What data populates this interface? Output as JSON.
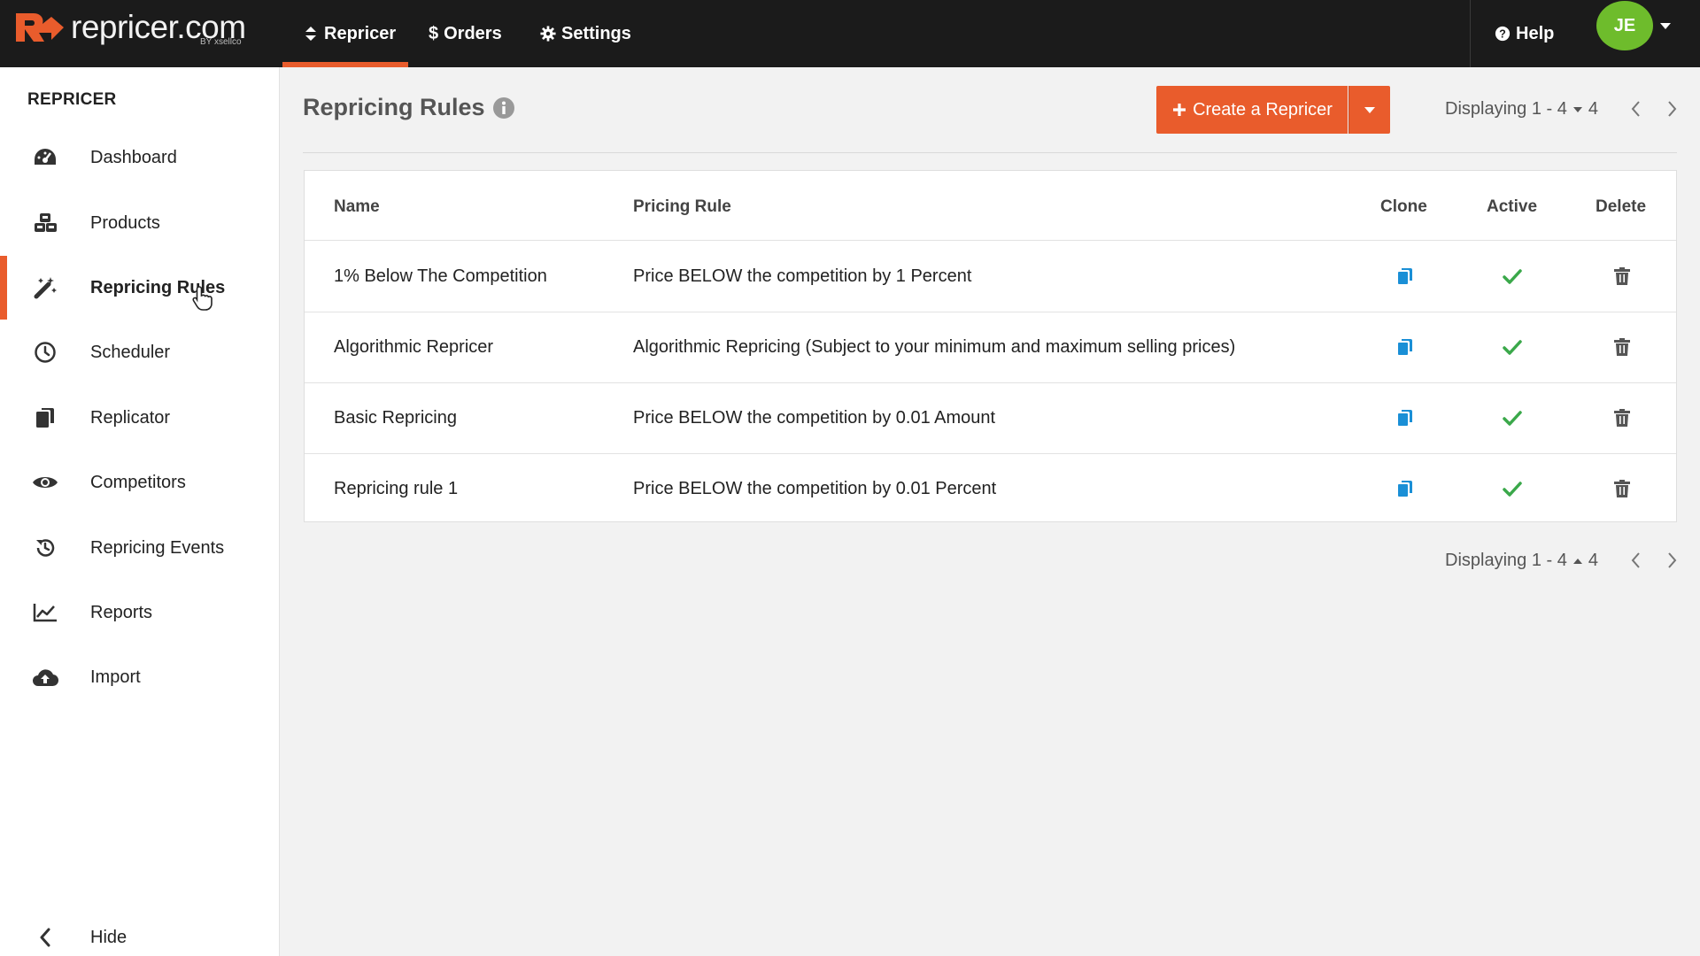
{
  "brand": {
    "name": "repricer.com",
    "sub": "BY xsellco",
    "accent": "#e95c2c"
  },
  "topnav": {
    "items": [
      {
        "label": "Repricer",
        "icon": "sort-icon"
      },
      {
        "label": "Orders",
        "icon": "dollar-icon"
      },
      {
        "label": "Settings",
        "icon": "gear-icon"
      }
    ],
    "active": "Repricer",
    "help": {
      "label": "Help",
      "icon": "question-circle-icon"
    },
    "user": {
      "initials": "JE",
      "color": "#6ebc2c"
    }
  },
  "sidebar": {
    "title": "REPRICER",
    "items": [
      {
        "label": "Dashboard",
        "icon": "dashboard-icon"
      },
      {
        "label": "Products",
        "icon": "cubes-icon"
      },
      {
        "label": "Repricing Rules",
        "icon": "magic-wand-icon",
        "active": true
      },
      {
        "label": "Scheduler",
        "icon": "clock-icon"
      },
      {
        "label": "Replicator",
        "icon": "copy-icon"
      },
      {
        "label": "Competitors",
        "icon": "eye-icon"
      },
      {
        "label": "Repricing Events",
        "icon": "history-icon"
      },
      {
        "label": "Reports",
        "icon": "line-chart-icon"
      },
      {
        "label": "Import",
        "icon": "cloud-upload-icon"
      }
    ],
    "hide_label": "Hide"
  },
  "main": {
    "title": "Repricing Rules",
    "create_button": "Create a Repricer",
    "pager_top": {
      "text": "Displaying 1 - 4",
      "total": "4"
    },
    "pager_bottom": {
      "text": "Displaying 1 - 4",
      "total": "4"
    },
    "table": {
      "headers": [
        "Name",
        "Pricing Rule",
        "Clone",
        "Active",
        "Delete"
      ],
      "rows": [
        {
          "name": "1% Below The Competition",
          "rule": "Price BELOW the competition by 1 Percent",
          "active": true
        },
        {
          "name": "Algorithmic Repricer",
          "rule": "Algorithmic Repricing (Subject to your minimum and maximum selling prices)",
          "active": true
        },
        {
          "name": "Basic Repricing",
          "rule": "Price BELOW the competition by 0.01 Amount",
          "active": true
        },
        {
          "name": "Repricing rule 1",
          "rule": "Price BELOW the competition by 0.01 Percent",
          "active": true
        }
      ]
    }
  },
  "colors": {
    "clone": "#1a8fd6",
    "active": "#3aa84a",
    "delete": "#555555"
  }
}
